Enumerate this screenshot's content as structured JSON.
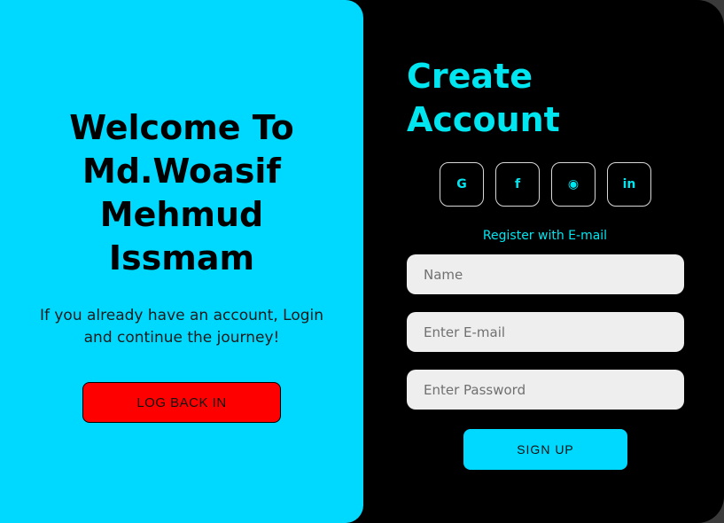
{
  "left": {
    "title": "Welcome To Md.Woasif Mehmud Issmam",
    "subtitle": "If you already have an account, Login and continue the journey!",
    "login_button": "LOG BACK IN"
  },
  "right": {
    "title": "Create Account",
    "socials": [
      {
        "name": "google-icon",
        "glyph": "G"
      },
      {
        "name": "facebook-icon",
        "glyph": "f"
      },
      {
        "name": "github-icon",
        "glyph": "◉"
      },
      {
        "name": "linkedin-icon",
        "glyph": "in"
      }
    ],
    "register_label": "Register with E-mail",
    "fields": {
      "name_placeholder": "Name",
      "email_placeholder": "Enter E-mail",
      "password_placeholder": "Enter Password"
    },
    "signup_button": "SIGN UP"
  },
  "colors": {
    "accent": "#00d9ff",
    "accent_text": "#00e6f0",
    "danger": "#ff0000",
    "background": "#000000"
  }
}
